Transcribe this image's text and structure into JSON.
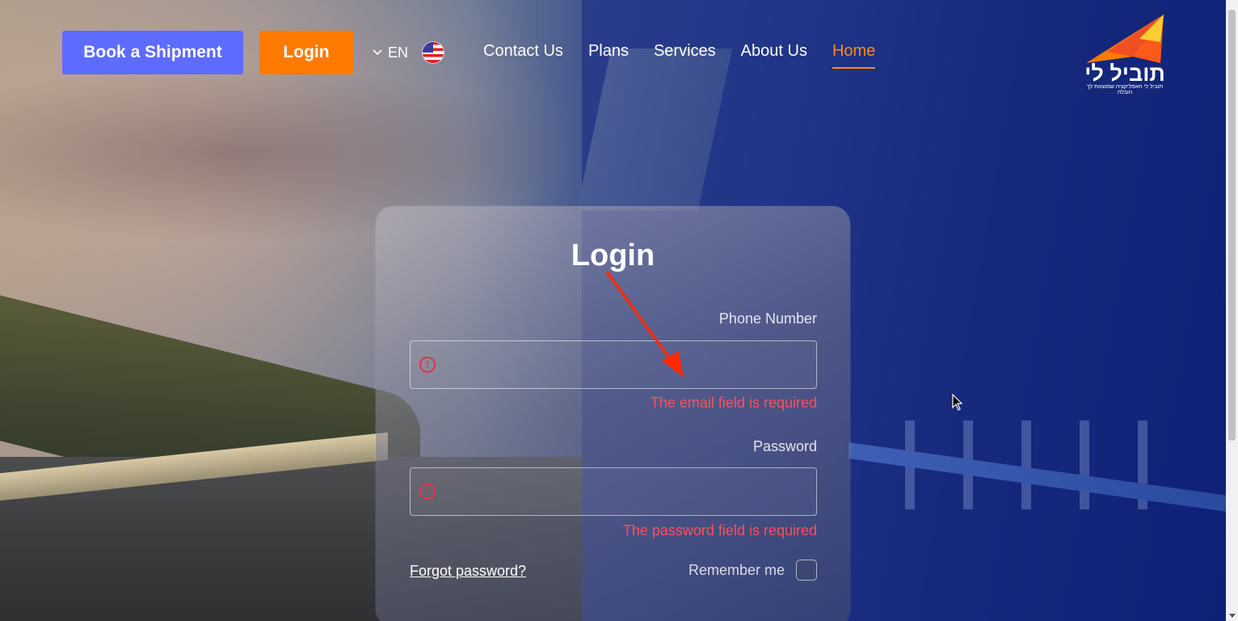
{
  "header": {
    "book_label": "Book a Shipment",
    "login_label": "Login",
    "language": "EN",
    "nav": [
      "Contact Us",
      "Plans",
      "Services",
      "About Us",
      "Home"
    ],
    "active_nav": "Home"
  },
  "logo": {
    "name": "תוביל לי",
    "tagline": "תוביל לי האפליקציה שמוצאת לך הובלה"
  },
  "login_form": {
    "title": "Login",
    "phone_label": "Phone Number",
    "phone_value": "",
    "phone_error": "The email field is required",
    "password_label": "Password",
    "password_value": "",
    "password_error": "The password field is required",
    "forgot_label": "Forgot password?",
    "remember_label": "Remember me",
    "remember_checked": false
  },
  "colors": {
    "primary_button": "#5e6bff",
    "login_button": "#ff7a00",
    "active_nav": "#ff8a1c",
    "error": "#ff4d5c"
  },
  "icons": [
    "chevron-down-icon",
    "us-flag-icon",
    "error-circle-icon",
    "mouse-cursor-icon"
  ]
}
